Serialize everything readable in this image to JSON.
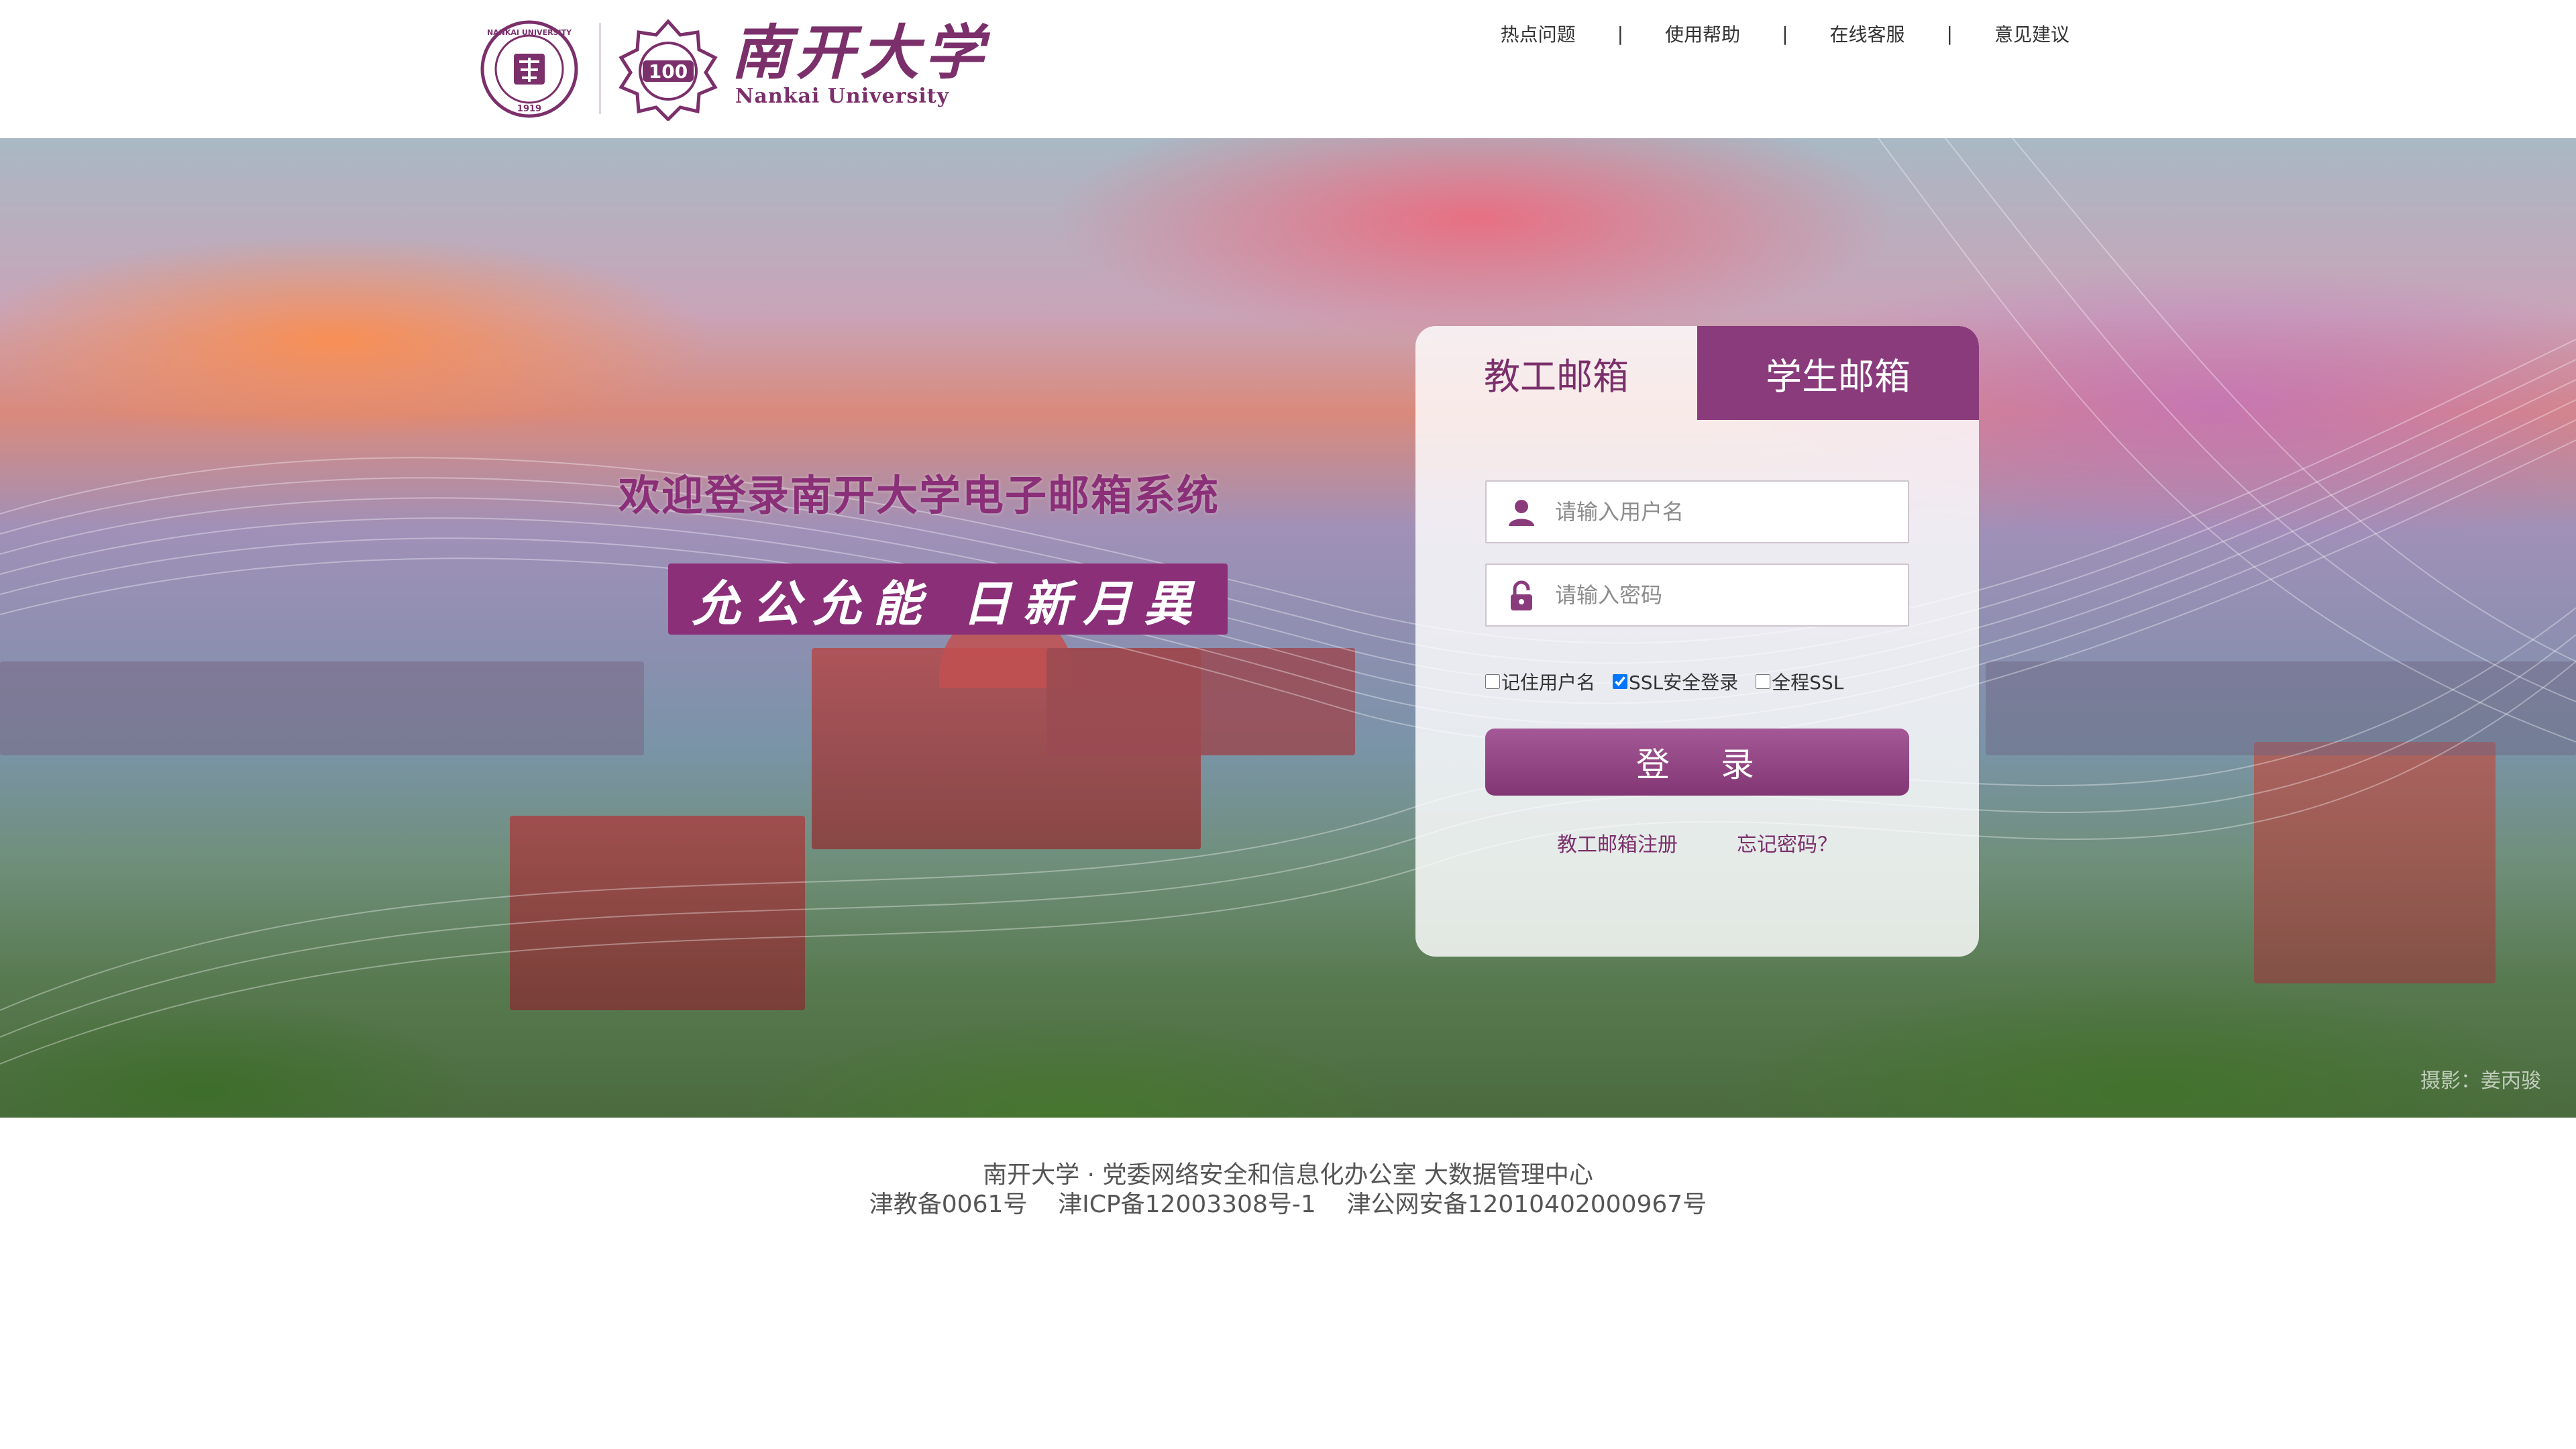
{
  "header": {
    "brand_cn": "南开大学",
    "brand_en": "Nankai University",
    "seal_text": "NANKAI UNIVERSITY",
    "seal_year": "1919",
    "centennial_text": "100",
    "links": [
      "热点问题",
      "使用帮助",
      "在线客服",
      "意见建议"
    ],
    "separator": "|"
  },
  "banner": {
    "welcome_title": "欢迎登录南开大学电子邮箱系统",
    "motto": "允公允能 日新月異",
    "photo_credit": "摄影：姜丙骏"
  },
  "login": {
    "tabs": [
      "教工邮箱",
      "学生邮箱"
    ],
    "active_tab": "学生邮箱",
    "username_placeholder": "请输入用户名",
    "password_placeholder": "请输入密码",
    "username_value": "",
    "password_value": "",
    "options": [
      {
        "label": "记住用户名",
        "checked": false
      },
      {
        "label": "SSL安全登录",
        "checked": true
      },
      {
        "label": "全程SSL",
        "checked": false
      }
    ],
    "login_button": "登 录",
    "register_link": "教工邮箱注册",
    "forgot_link": "忘记密码？"
  },
  "footer": {
    "line1": "南开大学 · 党委网络安全和信息化办公室 大数据管理中心",
    "line2": "津教备0061号    津ICP备12003308号-1    津公网安备12010402000967号"
  },
  "colors": {
    "brand_purple": "#8a3b7c",
    "brand_text": "#7b2f6b",
    "title_purple": "#8a2f78"
  },
  "icons": [
    "nankai-seal-icon",
    "centennial-badge-icon",
    "user-icon",
    "lock-icon"
  ]
}
